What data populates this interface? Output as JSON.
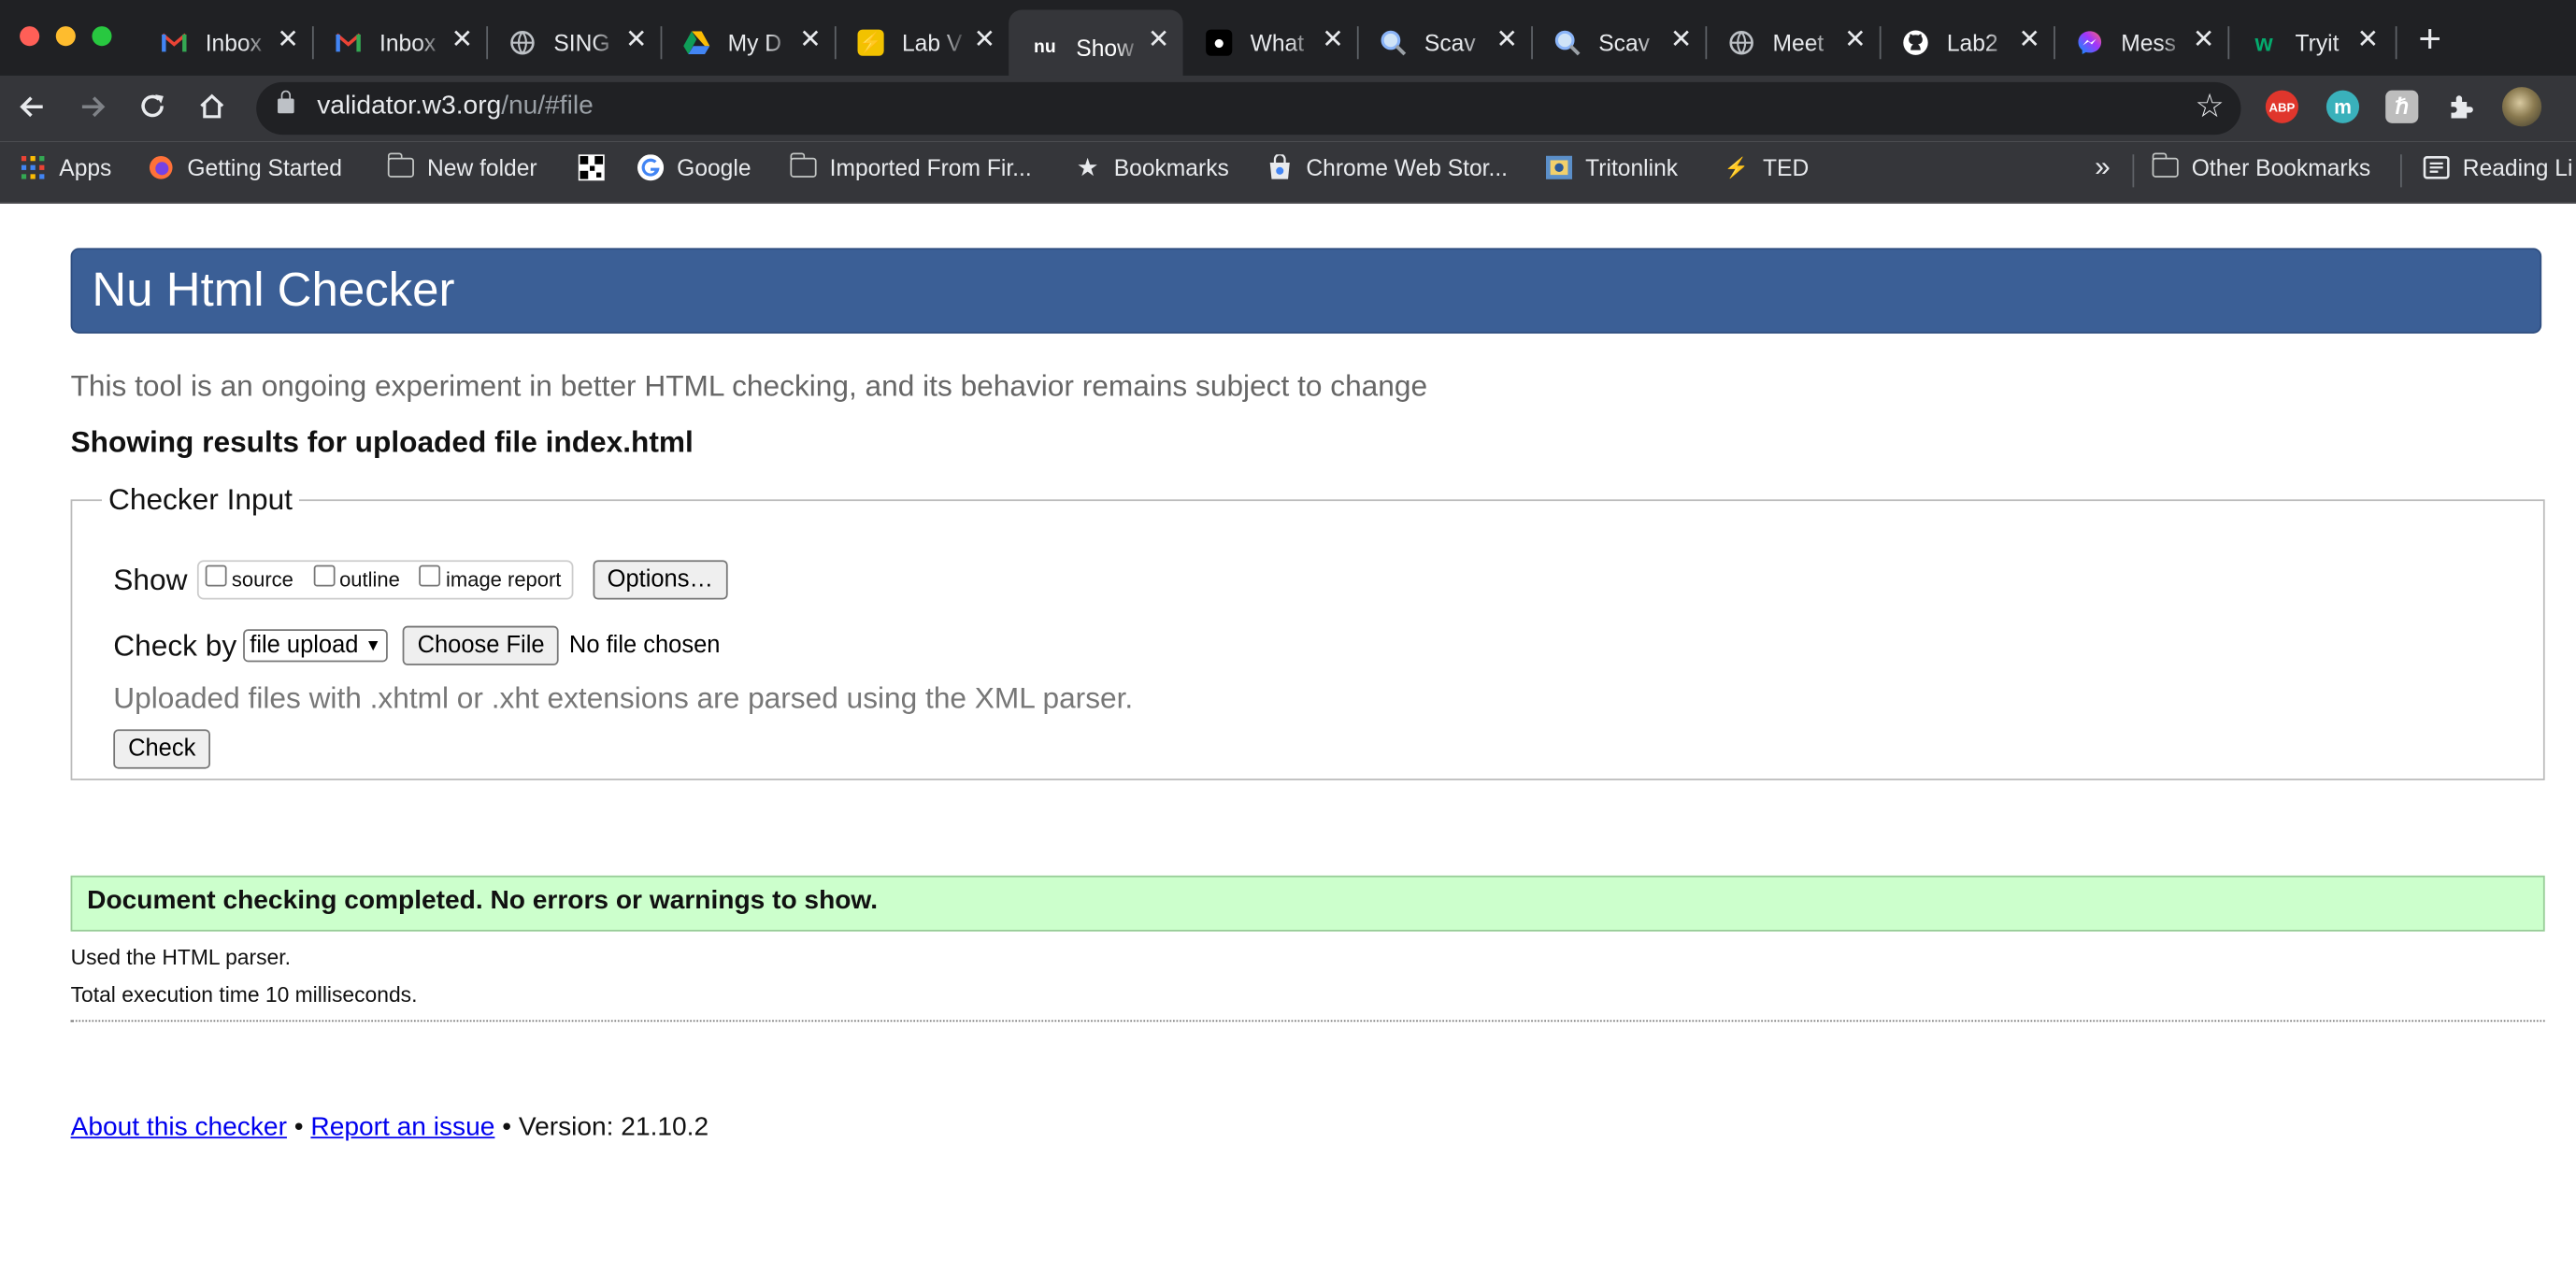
{
  "browser": {
    "tabs": [
      {
        "title": "Inbox",
        "icon": "gmail-icon"
      },
      {
        "title": "Inbox",
        "icon": "gmail-icon"
      },
      {
        "title": "SING",
        "icon": "globe-icon"
      },
      {
        "title": "My D",
        "icon": "google-drive-icon"
      },
      {
        "title": "Lab V",
        "icon": "lightning-icon"
      },
      {
        "title": "Show",
        "icon": "nu-icon",
        "active": true
      },
      {
        "title": "What",
        "icon": "chatgpt-icon"
      },
      {
        "title": "Scav",
        "icon": "search-icon"
      },
      {
        "title": "Scav",
        "icon": "search-icon"
      },
      {
        "title": "Meet",
        "icon": "globe-icon"
      },
      {
        "title": "Lab2",
        "icon": "github-icon"
      },
      {
        "title": "Mess",
        "icon": "messenger-icon"
      },
      {
        "title": "Tryit",
        "icon": "w3schools-icon"
      }
    ],
    "url_host": "validator.w3.org",
    "url_path": "/nu/#file",
    "extensions": [
      "ABP",
      "m",
      "ℏ"
    ],
    "bookmarks": {
      "apps": "Apps",
      "getting_started": "Getting Started",
      "new_folder": "New folder",
      "google": "Google",
      "imported": "Imported From Fir...",
      "bookmarks": "Bookmarks",
      "chrome_store": "Chrome Web Stor...",
      "tritonlink": "Tritonlink",
      "ted": "TED",
      "overflow": "»",
      "other": "Other Bookmarks",
      "reading": "Reading Li"
    }
  },
  "page": {
    "title": "Nu Html Checker",
    "intro": "This tool is an ongoing experiment in better HTML checking, and its behavior remains subject to change",
    "results_for": "Showing results for uploaded file index.html",
    "checker": {
      "legend": "Checker Input",
      "show_label": "Show",
      "show_options": {
        "source": "source",
        "outline": "outline",
        "image_report": "image report"
      },
      "options_button": "Options…",
      "check_by_label": "Check by",
      "check_by_value": "file upload",
      "choose_file": "Choose File",
      "no_file": "No file chosen",
      "note": "Uploaded files with .xhtml or .xht extensions are parsed using the XML parser.",
      "check_button": "Check"
    },
    "result": "Document checking completed. No errors or warnings to show.",
    "stats": {
      "parser": "Used the HTML parser.",
      "time": "Total execution time 10 milliseconds."
    },
    "footer": {
      "about": "About this checker",
      "bullet1": " • ",
      "report": "Report an issue",
      "version": " • Version: 21.10.2"
    }
  }
}
